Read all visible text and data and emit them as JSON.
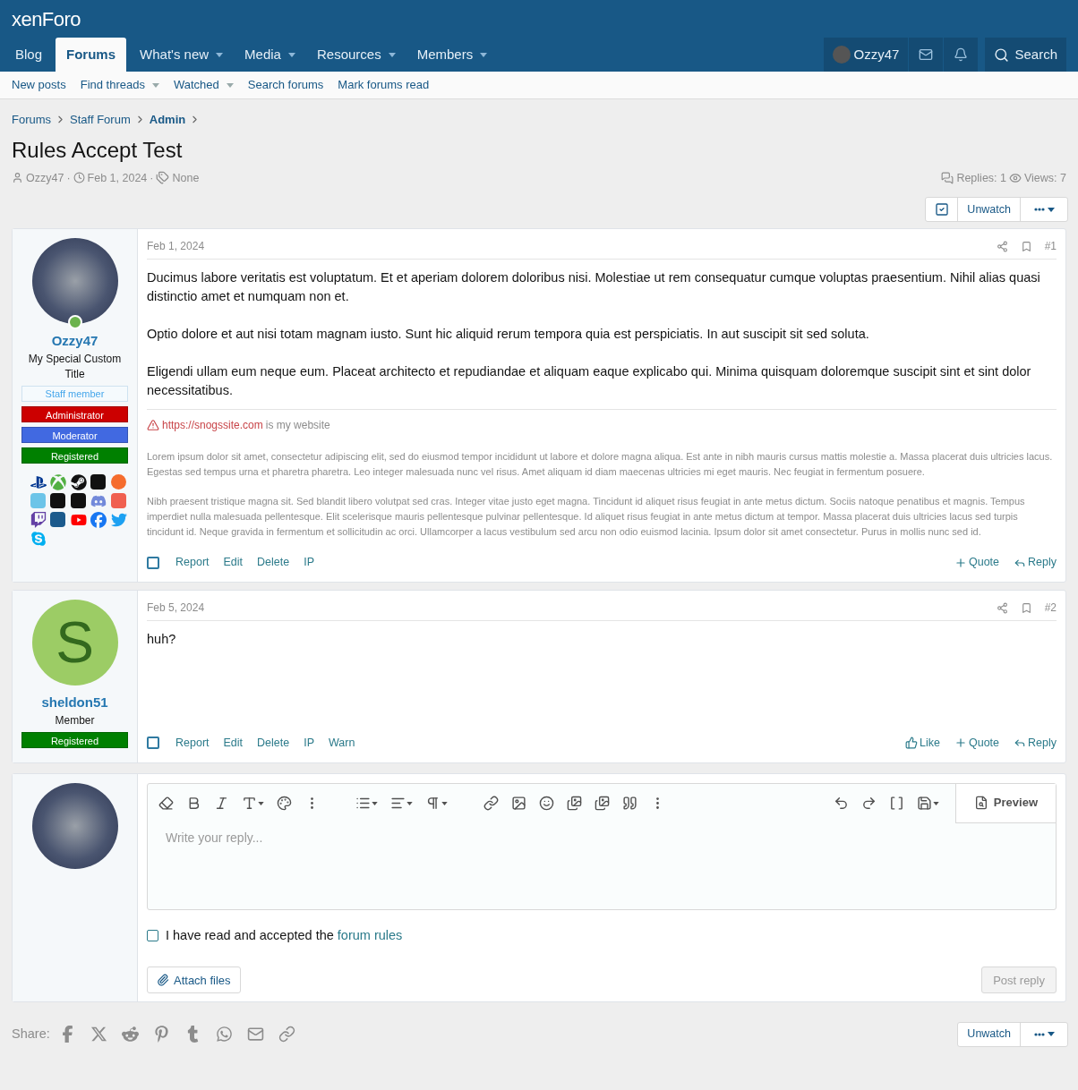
{
  "header": {
    "logo": "xenForo"
  },
  "nav": {
    "tabs": [
      {
        "label": "Blog",
        "selected": false,
        "menu": false
      },
      {
        "label": "Forums",
        "selected": true,
        "menu": false
      },
      {
        "label": "What's new",
        "selected": false,
        "menu": true
      },
      {
        "label": "Media",
        "selected": false,
        "menu": true
      },
      {
        "label": "Resources",
        "selected": false,
        "menu": true
      },
      {
        "label": "Members",
        "selected": false,
        "menu": true
      }
    ],
    "user": "Ozzy47",
    "search": "Search"
  },
  "subnav": [
    {
      "label": "New posts",
      "menu": false
    },
    {
      "label": "Find threads",
      "menu": true
    },
    {
      "label": "Watched",
      "menu": true
    },
    {
      "label": "Search forums",
      "menu": false
    },
    {
      "label": "Mark forums read",
      "menu": false
    }
  ],
  "breadcrumbs": [
    {
      "label": "Forums",
      "current": false
    },
    {
      "label": "Staff Forum",
      "current": false
    },
    {
      "label": "Admin",
      "current": true
    }
  ],
  "thread": {
    "title": "Rules Accept Test",
    "author": "Ozzy47",
    "separator_1": "·",
    "date": "Feb 1, 2024",
    "separator_2": "·",
    "tags": "None",
    "replies": "Replies: 1",
    "views": "Views: 7"
  },
  "watch_button": "Unwatch",
  "footer_watch_button": "Unwatch",
  "posts": [
    {
      "user": {
        "name": "Ozzy47",
        "online": true,
        "title": "My Special Custom Title",
        "staff_label": "Staff member",
        "banners": [
          {
            "label": "Administrator",
            "color": "#cc0000"
          },
          {
            "label": "Moderator",
            "color": "#4169e1"
          },
          {
            "label": "Registered",
            "color": "#008000"
          }
        ],
        "logos": true
      },
      "date": "Feb 1, 2024",
      "number": "#1",
      "paragraphs": [
        "Ducimus labore veritatis est voluptatum. Et et aperiam dolorem doloribus nisi. Molestiae ut rem consequatur cumque voluptas praesentium. Nihil alias quasi distinctio amet et numquam non et.",
        "Optio dolore et aut nisi totam magnam iusto. Sunt hic aliquid rerum tempora quia est perspiciatis. In aut suscipit sit sed soluta.",
        "Eligendi ullam eum neque eum. Placeat architecto et repudiandae et aliquam eaque explicabo qui. Minima quisquam doloremque suscipit sint et sint dolor necessitatibus."
      ],
      "signature": {
        "link": "https://snogssite.com",
        "after": "is my website",
        "paragraphs": [
          "Lorem ipsum dolor sit amet, consectetur adipiscing elit, sed do eiusmod tempor incididunt ut labore et dolore magna aliqua. Est ante in nibh mauris cursus mattis molestie a. Massa placerat duis ultricies lacus. Egestas sed tempus urna et pharetra pharetra. Leo integer malesuada nunc vel risus. Amet aliquam id diam maecenas ultricies mi eget mauris. Nec feugiat in fermentum posuere.",
          "Nibh praesent tristique magna sit. Sed blandit libero volutpat sed cras. Integer vitae justo eget magna. Tincidunt id aliquet risus feugiat in ante metus dictum. Sociis natoque penatibus et magnis. Tempus imperdiet nulla malesuada pellentesque. Elit scelerisque mauris pellentesque pulvinar pellentesque. Id aliquet risus feugiat in ante metus dictum at tempor. Massa placerat duis ultricies lacus sed turpis tincidunt id. Neque gravida in fermentum et sollicitudin ac orci. Ullamcorper a lacus vestibulum sed arcu non odio euismod lacinia. Ipsum dolor sit amet consectetur. Purus in mollis nunc sed id."
        ]
      },
      "selected": false,
      "actions": [
        "Report",
        "Edit",
        "Delete",
        "IP"
      ],
      "reactions": [
        {
          "kind": "quote",
          "label": "Quote"
        },
        {
          "kind": "reply",
          "label": "Reply"
        }
      ]
    },
    {
      "user": {
        "name": "sheldon51",
        "letter": "S",
        "online": false,
        "title": "Member",
        "banners": [
          {
            "label": "Registered",
            "color": "#008000"
          }
        ]
      },
      "date": "Feb 5, 2024",
      "number": "#2",
      "paragraphs": [
        "huh?"
      ],
      "selected": false,
      "actions": [
        "Report",
        "Edit",
        "Delete",
        "IP",
        "Warn"
      ],
      "reactions": [
        {
          "kind": "like",
          "label": "Like"
        },
        {
          "kind": "quote",
          "label": "Quote"
        },
        {
          "kind": "reply",
          "label": "Reply"
        }
      ]
    }
  ],
  "reply": {
    "placeholder": "Write your reply...",
    "preview": "Preview",
    "rules": {
      "checked": false,
      "text": "I have read and accepted the",
      "link": "forum rules"
    },
    "attach": "Attach files",
    "submit": "Post reply"
  },
  "share": {
    "label": "Share:"
  }
}
